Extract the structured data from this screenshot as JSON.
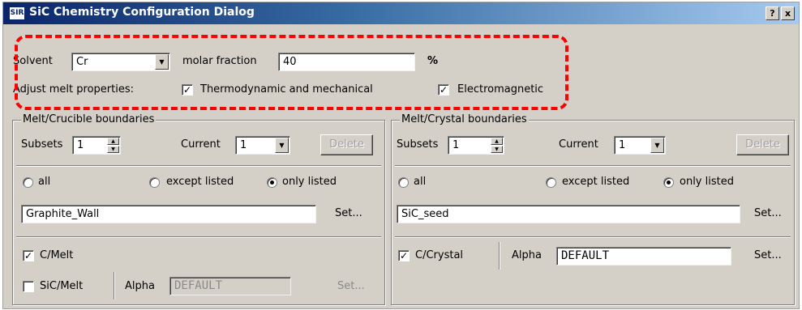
{
  "window": {
    "app_icon_text": "SIR",
    "title": "SiC Chemistry Configuration Dialog",
    "help_button": "?",
    "close_button": "x"
  },
  "solvent": {
    "label": "Solvent",
    "value": "Cr",
    "molar_fraction_label": "molar fraction",
    "molar_fraction_value": "40",
    "unit": "%"
  },
  "adjust": {
    "label": "Adjust melt properties:",
    "thermo_label": "Thermodynamic and mechanical",
    "thermo_checked": true,
    "em_label": "Electromagnetic",
    "em_checked": true
  },
  "melt_crucible": {
    "title": "Melt/Crucible boundaries",
    "subsets_label": "Subsets",
    "subsets_value": "1",
    "current_label": "Current",
    "current_value": "1",
    "delete_label": "Delete",
    "radio_all": "all",
    "radio_except": "except listed",
    "radio_only": "only listed",
    "selected_radio": "only listed",
    "list_value": "Graphite_Wall",
    "set_label": "Set...",
    "c_melt_label": "C/Melt",
    "c_melt_checked": true,
    "sic_melt_label": "SiC/Melt",
    "sic_melt_checked": false,
    "alpha_label": "Alpha",
    "alpha_value": "DEFAULT",
    "alpha_set_label": "Set..."
  },
  "melt_crystal": {
    "title": "Melt/Crystal boundaries",
    "subsets_label": "Subsets",
    "subsets_value": "1",
    "current_label": "Current",
    "current_value": "1",
    "delete_label": "Delete",
    "radio_all": "all",
    "radio_except": "except listed",
    "radio_only": "only listed",
    "selected_radio": "only listed",
    "list_value": "SiC_seed",
    "set_label": "Set...",
    "c_crystal_label": "C/Crystal",
    "c_crystal_checked": true,
    "alpha_label": "Alpha",
    "alpha_value": "DEFAULT",
    "alpha_set_label": "Set..."
  },
  "icons": {
    "check": "✓",
    "dropdown": "▼",
    "spin_up": "▲",
    "spin_down": "▼"
  },
  "colors": {
    "dialog_bg": "#d4d0c8",
    "title_bar": "#0a246a",
    "highlight_dash": "#ff0000"
  }
}
